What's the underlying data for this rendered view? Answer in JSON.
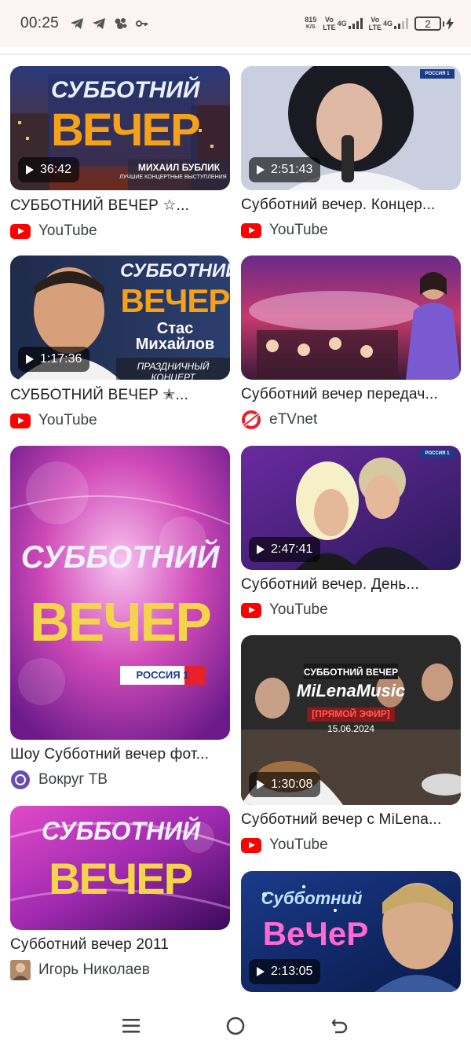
{
  "status_bar": {
    "time": "00:25",
    "net_speed_value": "815",
    "net_speed_unit": "K/S",
    "sim1_label_top": "Vo",
    "sim1_label_bottom": "LTE",
    "sim1_net": "4G",
    "sim2_label_top": "Vo",
    "sim2_label_bottom": "LTE",
    "sim2_net": "4G",
    "battery_level": "2"
  },
  "results": [
    {
      "title": "СУББОТНИЙ ВЕЧЕР ☆...",
      "source": "YouTube",
      "duration": "36:42",
      "thumb_text_top": "СУББОТНИЙ",
      "thumb_text_main": "ВЕЧЕР",
      "thumb_text_sub": "МИХАИЛ БУБЛИК",
      "thumb_text_sub2": "ЛУЧШИЕ КОНЦЕРТНЫЕ ВЫСТУПЛЕНИЯ"
    },
    {
      "title": "Субботний вечер. Концер...",
      "source": "YouTube",
      "duration": "2:51:43",
      "thumb_badge": "РОССИЯ 1"
    },
    {
      "title": "СУББОТНИЙ ВЕЧЕР ✭...",
      "source": "YouTube",
      "duration": "1:17:36",
      "thumb_text_top": "СУББОТНИЙ",
      "thumb_text_main": "ВЕЧЕР",
      "thumb_text_sub": "Стас",
      "thumb_text_sub2": "Михайлов",
      "thumb_text_sub3": "ПРАЗДНИЧНЫЙ КОНЦЕРТ"
    },
    {
      "title": "Субботний вечер передач...",
      "source": "eTVnet"
    },
    {
      "title": "Шоу Субботний вечер фот...",
      "source": "Вокруг ТВ",
      "thumb_text_top": "СУББОТНИЙ",
      "thumb_text_main": "ВЕЧЕР",
      "thumb_badge": "РОССИЯ 1"
    },
    {
      "title": "Субботний вечер. День...",
      "source": "YouTube",
      "duration": "2:47:41",
      "thumb_badge": "РОССИЯ 1"
    },
    {
      "title": "Субботний вечер с MiLena...",
      "source": "YouTube",
      "duration": "1:30:08",
      "thumb_text_top": "СУББОТНИЙ ВЕЧЕР",
      "thumb_text_main": "MiLenaMusic",
      "thumb_text_sub": "[ПРЯМОЙ ЭФИР]",
      "thumb_text_sub2": "15.06.2024"
    },
    {
      "title": "Субботний вечер 2011",
      "source": "Игорь Николаев",
      "thumb_text_top": "СУББОТНИЙ",
      "thumb_text_main": "ВЕЧЕР"
    },
    {
      "title": "",
      "source": "",
      "duration": "2:13:05",
      "thumb_text_top": "Субботний",
      "thumb_text_main": "ВеЧеР"
    }
  ],
  "colors": {
    "youtube_red": "#ff0000",
    "status_bar_bg": "#fbf3f4",
    "etvnet_red": "#e8202a",
    "vokrug_purple": "#6a4bb3"
  },
  "icons": {
    "nav_left": "recent-apps-icon",
    "nav_center": "home-icon",
    "nav_right": "back-icon"
  }
}
